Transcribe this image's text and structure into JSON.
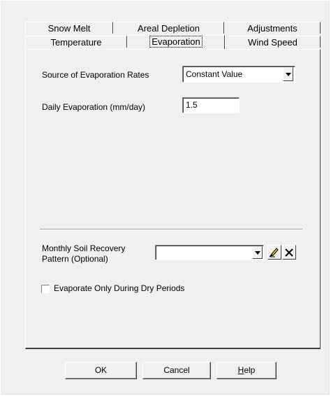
{
  "tabs": {
    "row_back": [
      "Snow Melt",
      "Areal Depletion",
      "Adjustments"
    ],
    "row_front": [
      "Temperature",
      "Evaporation",
      "Wind Speed"
    ],
    "selected": "Evaporation"
  },
  "evaporation": {
    "source_label": "Source of Evaporation  Rates",
    "source_value": "Constant Value",
    "daily_label": "Daily Evaporation (mm/day)",
    "daily_value": "1.5",
    "soil_label_line1": "Monthly Soil Recovery",
    "soil_label_line2": "Pattern (Optional)",
    "soil_value": "",
    "checkbox_label": "Evaporate Only During Dry Periods",
    "checkbox_checked": false
  },
  "buttons": {
    "ok": "OK",
    "cancel": "Cancel",
    "help_prefix": "H",
    "help_rest": "elp"
  }
}
